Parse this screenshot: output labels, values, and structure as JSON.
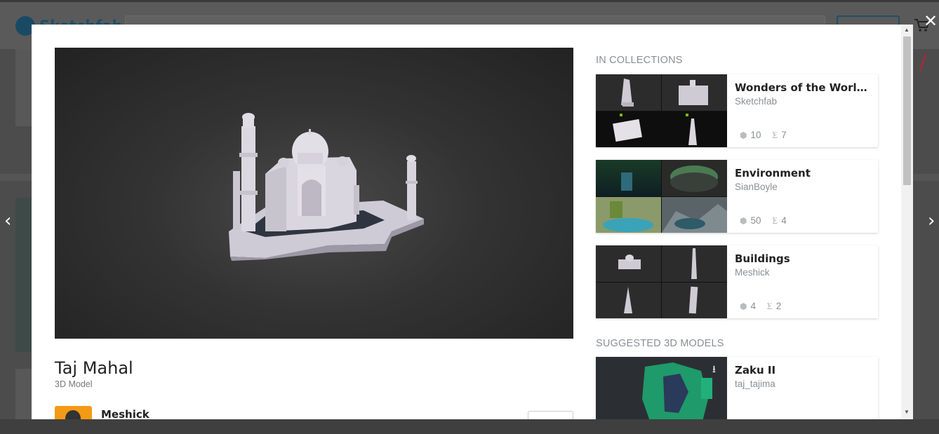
{
  "background": {
    "logo_text": "Sketchfab"
  },
  "modal": {
    "model": {
      "title": "Taj Mahal",
      "subtitle": "3D Model",
      "author": "Meshick"
    },
    "collections_heading": "IN COLLECTIONS",
    "collections": [
      {
        "name": "Wonders of the World f...",
        "author": "Sketchfab",
        "models": "10",
        "followers": "7"
      },
      {
        "name": "Environment",
        "author": "SianBoyle",
        "models": "50",
        "followers": "4"
      },
      {
        "name": "Buildings",
        "author": "Meshick",
        "models": "4",
        "followers": "2"
      }
    ],
    "suggested_heading": "SUGGESTED 3D MODELS",
    "suggested": [
      {
        "name": "Zaku II",
        "author": "taj_tajima"
      }
    ]
  },
  "icons": {
    "prev": "chevron-left-icon",
    "next": "chevron-right-icon",
    "close": "close-icon",
    "models": "cube-icon",
    "followers": "rss-icon",
    "download": "download-icon"
  },
  "colors": {
    "brand": "#1caad9",
    "avatar_bg": "#f39a16",
    "muted_text": "#8a8f94"
  }
}
